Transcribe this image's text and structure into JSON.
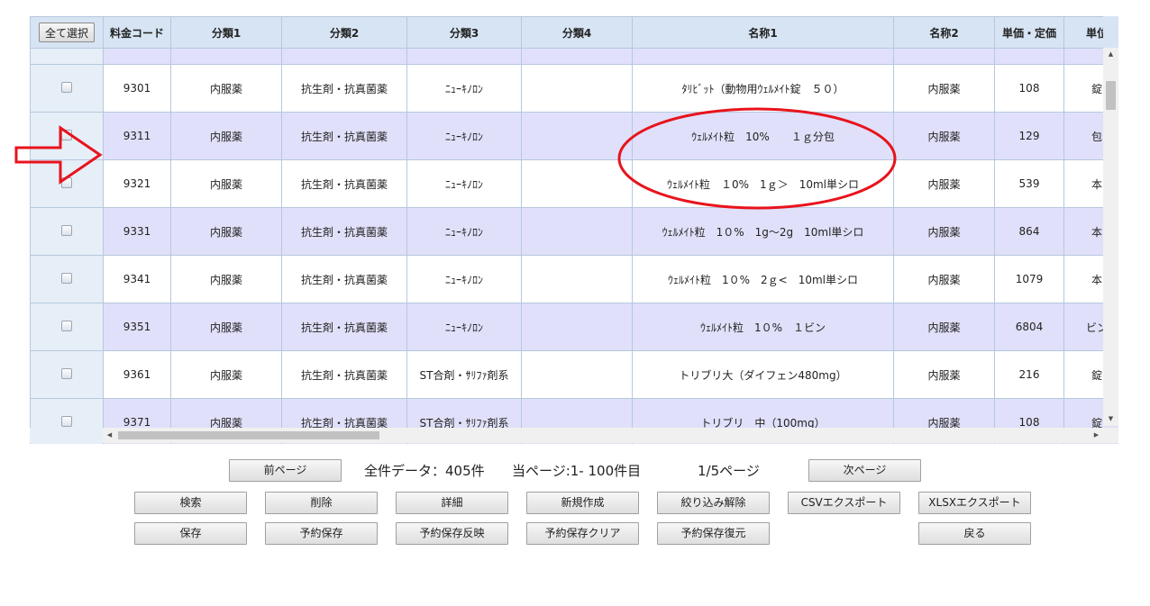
{
  "grid": {
    "select_all_label": "全て選択",
    "columns": [
      "料金コード",
      "分類1",
      "分類2",
      "分類3",
      "分類4",
      "名称1",
      "名称2",
      "単価・定価",
      "単位"
    ],
    "rows": [
      {
        "code": "9301",
        "cat1": "内服薬",
        "cat2": "抗生剤・抗真菌薬",
        "cat3": "ﾆｭｰｷﾉﾛﾝ",
        "cat4": "",
        "name1": "ﾀﾘﾋﾞｯﾄ（動物用ｳｪﾙﾒｲﾄ錠　５０）",
        "name2": "内服薬",
        "price": "108",
        "unit": "錠"
      },
      {
        "code": "9311",
        "cat1": "内服薬",
        "cat2": "抗生剤・抗真菌薬",
        "cat3": "ﾆｭｰｷﾉﾛﾝ",
        "cat4": "",
        "name1": "ｳｪﾙﾒｲﾄ粒　10%　　１ｇ分包",
        "name2": "内服薬",
        "price": "129",
        "unit": "包"
      },
      {
        "code": "9321",
        "cat1": "内服薬",
        "cat2": "抗生剤・抗真菌薬",
        "cat3": "ﾆｭｰｷﾉﾛﾝ",
        "cat4": "",
        "name1": "ｳｪﾙﾒｲﾄ粒　１0%　1ｇ＞　10ml単シロ",
        "name2": "内服薬",
        "price": "539",
        "unit": "本"
      },
      {
        "code": "9331",
        "cat1": "内服薬",
        "cat2": "抗生剤・抗真菌薬",
        "cat3": "ﾆｭｰｷﾉﾛﾝ",
        "cat4": "",
        "name1": "ｳｪﾙﾒｲﾄ粒　1０%　1g～2g　10ml単シロ",
        "name2": "内服薬",
        "price": "864",
        "unit": "本"
      },
      {
        "code": "9341",
        "cat1": "内服薬",
        "cat2": "抗生剤・抗真菌薬",
        "cat3": "ﾆｭｰｷﾉﾛﾝ",
        "cat4": "",
        "name1": "ｳｪﾙﾒｲﾄ粒　1０%　2ｇ<　10ml単シロ",
        "name2": "内服薬",
        "price": "1079",
        "unit": "本"
      },
      {
        "code": "9351",
        "cat1": "内服薬",
        "cat2": "抗生剤・抗真菌薬",
        "cat3": "ﾆｭｰｷﾉﾛﾝ",
        "cat4": "",
        "name1": "ｳｪﾙﾒｲﾄ粒　1０%　１ビン",
        "name2": "内服薬",
        "price": "6804",
        "unit": "ビン"
      },
      {
        "code": "9361",
        "cat1": "内服薬",
        "cat2": "抗生剤・抗真菌薬",
        "cat3": "ST合剤・ｻﾘﾌｧ剤系",
        "cat4": "",
        "name1": "トリブリ大（ダイフェン480mg）",
        "name2": "内服薬",
        "price": "216",
        "unit": "錠"
      },
      {
        "code": "9371",
        "cat1": "内服薬",
        "cat2": "抗生剤・抗真菌薬",
        "cat3": "ST合剤・ｻﾘﾌｧ剤系",
        "cat4": "",
        "name1": "トリブリ　中（100mg）",
        "name2": "内服薬",
        "price": "108",
        "unit": "錠"
      }
    ]
  },
  "pager": {
    "prev_label": "前ページ",
    "total_text": "全件データ：405件",
    "current_text": "当ページ:1- 100件目",
    "page_text": "1/5ページ",
    "next_label": "次ページ"
  },
  "actions": {
    "search": "検索",
    "delete": "削除",
    "detail": "詳細",
    "create": "新規作成",
    "clear_filter": "絞り込み解除",
    "csv_export": "CSVエクスポート",
    "xlsx_export": "XLSXエクスポート",
    "save": "保存",
    "reserve_save": "予約保存",
    "reserve_apply": "予約保存反映",
    "reserve_clear": "予約保存クリア",
    "reserve_restore": "予約保存復元",
    "back": "戻る"
  },
  "colors": {
    "header_bg": "#d7e4f4",
    "row_alt_bg": "#e0e0fa",
    "annotation_red": "#e8131c"
  }
}
